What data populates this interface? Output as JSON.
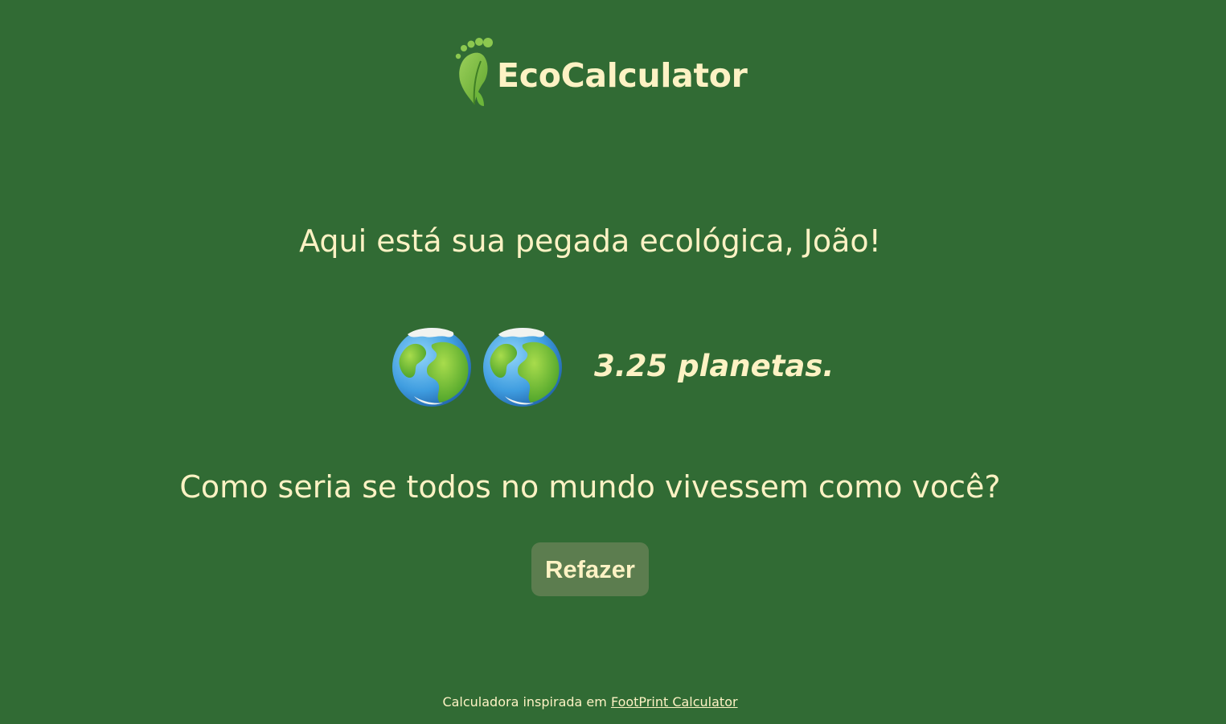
{
  "header": {
    "brand": "EcoCalculator",
    "logo_icon": "footprint-leaf-icon"
  },
  "result": {
    "greeting": "Aqui está sua pegada ecológica, João!",
    "planet_count": 3.25,
    "planets_shown": 2,
    "planet_icon": "earth-globe-icon",
    "value_text": "3.25 planetas."
  },
  "question": "Como seria se todos no mundo vivessem como você?",
  "actions": {
    "redo_label": "Refazer"
  },
  "footer": {
    "text": "Calculadora inspirada em",
    "link_label": "FootPrint Calculator"
  },
  "colors": {
    "background": "#316b34",
    "text": "#fdf2c4",
    "button": "#5c7d4f",
    "leaf_green": "#7cc142"
  }
}
